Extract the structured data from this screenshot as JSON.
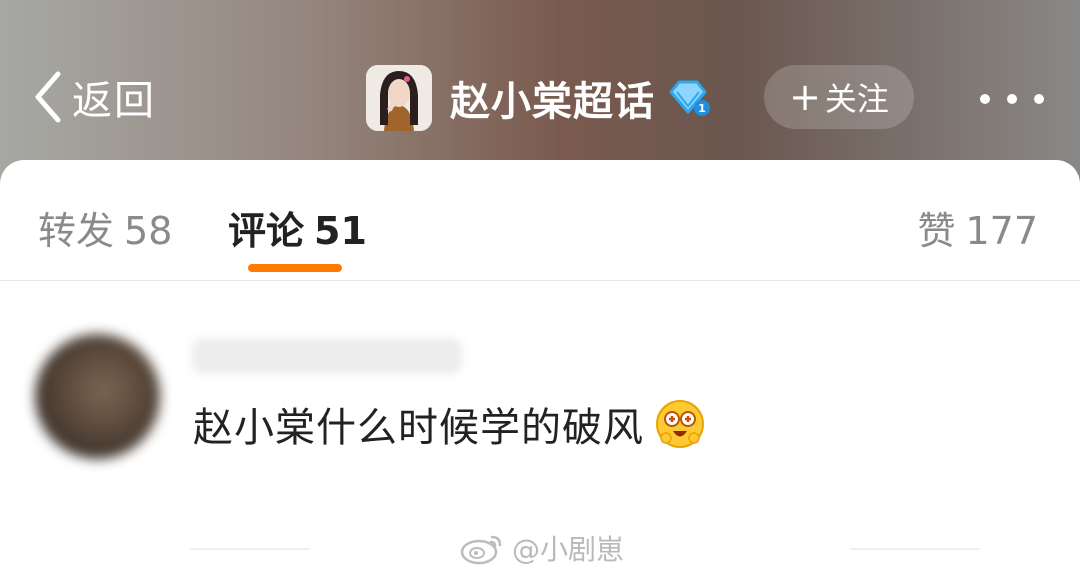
{
  "header": {
    "back_label": "返回",
    "topic_title": "赵小棠超话",
    "follow_label": "关注",
    "follow_plus": "+",
    "more_icon": "more-horizontal-icon",
    "diamond_icon": "diamond-badge-icon"
  },
  "tabs": {
    "repost": {
      "label": "转发",
      "count": "58"
    },
    "comment": {
      "label": "评论",
      "count": "51"
    },
    "like": {
      "label": "赞",
      "count": "177"
    }
  },
  "comment": {
    "text": "赵小棠什么时候学的破风",
    "emoji_icon": "grinning-eyes-emoji-icon"
  },
  "watermark": {
    "text": "@小剧崽",
    "icon": "weibo-logo-icon"
  },
  "colors": {
    "accent": "#ff7a00",
    "tab_active": "#222222",
    "tab_inactive": "#8a8a8a"
  }
}
